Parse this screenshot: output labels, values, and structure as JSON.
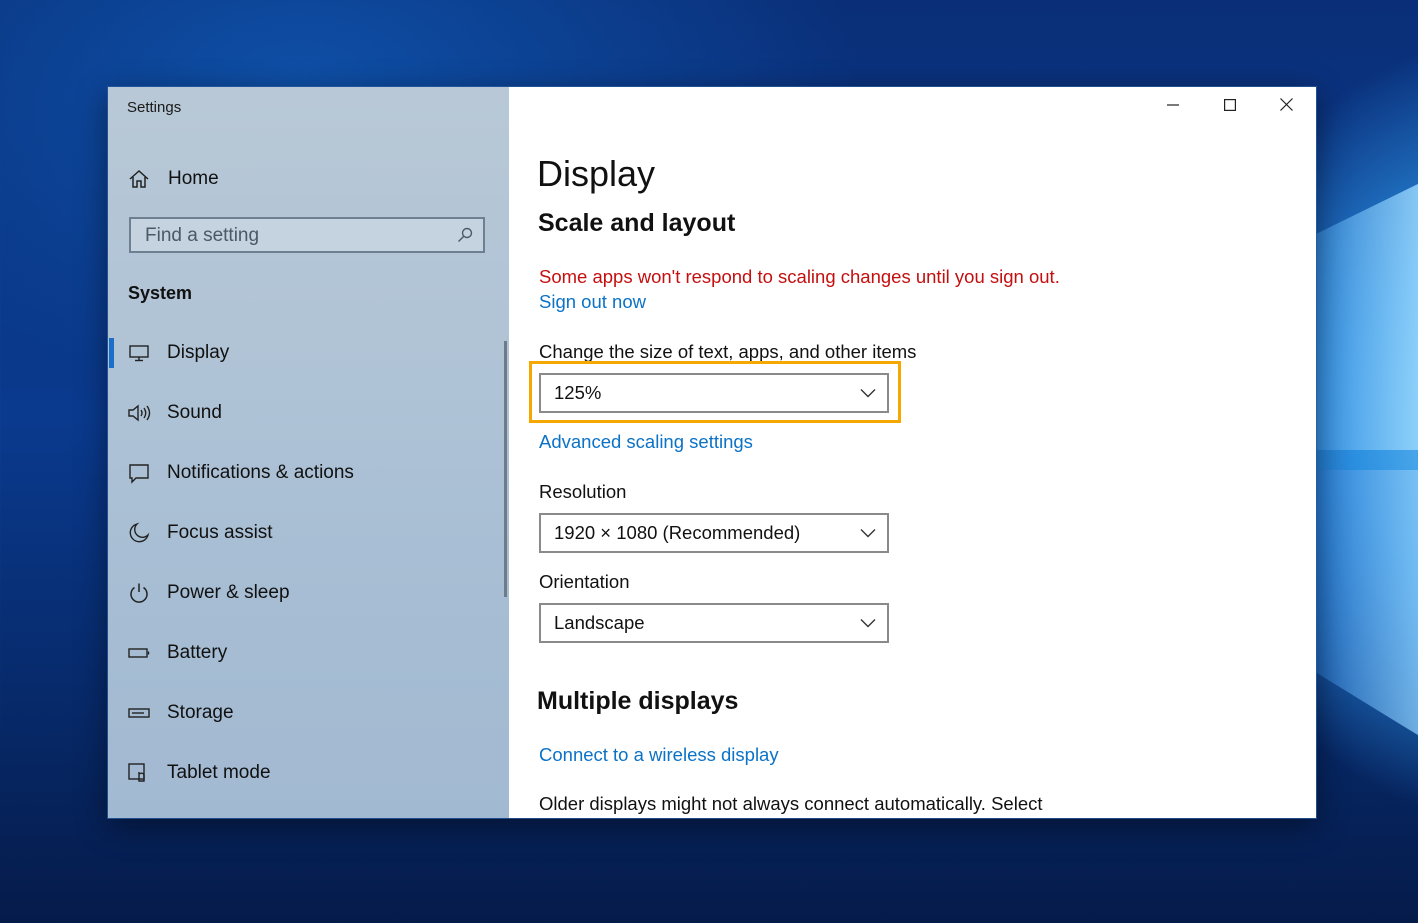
{
  "window": {
    "app_title": "Settings",
    "caption": {
      "minimize_icon": "minimize-icon",
      "maximize_icon": "maximize-icon",
      "close_icon": "close-icon"
    }
  },
  "sidebar": {
    "home_label": "Home",
    "search": {
      "placeholder": "Find a setting",
      "value": ""
    },
    "section_title": "System",
    "items": [
      {
        "label": "Display",
        "icon": "monitor-icon",
        "selected": true
      },
      {
        "label": "Sound",
        "icon": "speaker-icon",
        "selected": false
      },
      {
        "label": "Notifications & actions",
        "icon": "notification-icon",
        "selected": false
      },
      {
        "label": "Focus assist",
        "icon": "moon-icon",
        "selected": false
      },
      {
        "label": "Power & sleep",
        "icon": "power-icon",
        "selected": false
      },
      {
        "label": "Battery",
        "icon": "battery-icon",
        "selected": false
      },
      {
        "label": "Storage",
        "icon": "storage-drive-icon",
        "selected": false
      },
      {
        "label": "Tablet mode",
        "icon": "tablet-mode-icon",
        "selected": false
      }
    ]
  },
  "main": {
    "title": "Display",
    "scale_section": {
      "heading": "Scale and layout",
      "warning": "Some apps won't respond to scaling changes until you sign out.",
      "sign_out_link": "Sign out now",
      "size_label": "Change the size of text, apps, and other items",
      "size_value": "125%",
      "advanced_link": "Advanced scaling settings",
      "resolution_label": "Resolution",
      "resolution_value": "1920 × 1080 (Recommended)",
      "orientation_label": "Orientation",
      "orientation_value": "Landscape"
    },
    "multiple_displays": {
      "heading": "Multiple displays",
      "wireless_link": "Connect to a wireless display",
      "description": "Older displays might not always connect automatically. Select"
    }
  },
  "colors": {
    "accent": "#0b72c6",
    "warning": "#c50f0f",
    "highlight": "#f5a800",
    "selection_bar": "#1a6fc7"
  }
}
